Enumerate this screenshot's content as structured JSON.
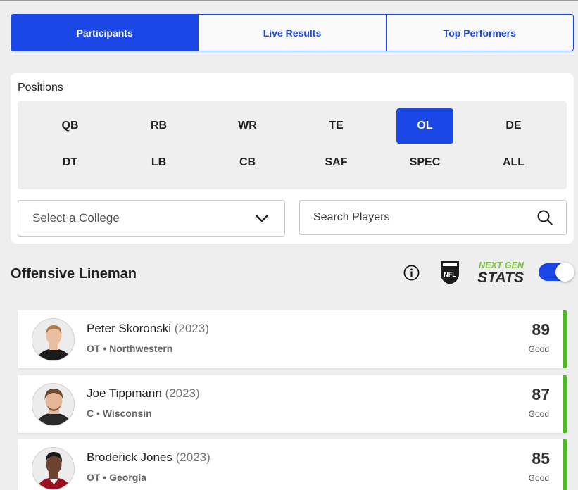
{
  "tabs": [
    {
      "label": "Participants",
      "active": true
    },
    {
      "label": "Live Results",
      "active": false
    },
    {
      "label": "Top Performers",
      "active": false
    }
  ],
  "filters": {
    "positions_label": "Positions",
    "positions": [
      "QB",
      "RB",
      "WR",
      "TE",
      "OL",
      "DE",
      "DT",
      "LB",
      "CB",
      "SAF",
      "SPEC",
      "ALL"
    ],
    "selected_position": "OL",
    "college_select": "Select a College",
    "search_placeholder": "Search Players"
  },
  "section": {
    "title": "Offensive Lineman",
    "ngs_logo": {
      "line1": "NEXT GEN",
      "line2": "STATS"
    },
    "toggle_on": true
  },
  "players": [
    {
      "name": "Peter Skoronski",
      "year": "(2023)",
      "detail": "OT • Northwestern",
      "score": "89",
      "grade": "Good",
      "skin": "#e8bfa1",
      "hair": "#b07a4a",
      "shirt": "#1c1c1c"
    },
    {
      "name": "Joe Tippmann",
      "year": "(2023)",
      "detail": "C • Wisconsin",
      "score": "87",
      "grade": "Good",
      "skin": "#e6b698",
      "hair": "#6b4a2e",
      "shirt": "#2a2a2a"
    },
    {
      "name": "Broderick Jones",
      "year": "(2023)",
      "detail": "OT • Georgia",
      "score": "85",
      "grade": "Good",
      "skin": "#6b4330",
      "hair": "#1a1a1a",
      "shirt": "#9a1020"
    }
  ],
  "colors": {
    "accent": "#1a47e6",
    "good": "#4aba1e",
    "ngs_green": "#7cc242"
  }
}
